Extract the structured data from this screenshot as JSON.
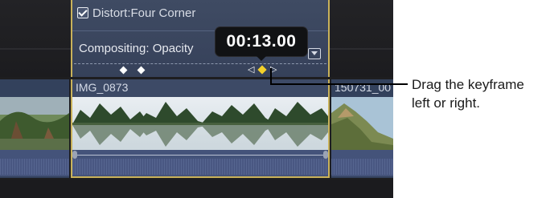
{
  "effect": {
    "distort_label": "Distort:Four Corner",
    "distort_checked": true,
    "opacity_label": "Compositing: Opacity"
  },
  "timecode": "00:13.00",
  "clips": [
    {
      "name": ""
    },
    {
      "name": "IMG_0873"
    },
    {
      "name": "150731_00"
    }
  ],
  "callout": {
    "line1": "Drag the keyframe",
    "line2": "left or right."
  },
  "colors": {
    "selection": "#c9b25a",
    "active_keyframe": "#f4d12a",
    "clip_blue": "#3d4a66"
  },
  "icons": [
    "checkbox-icon",
    "keyframe-icon",
    "previous-keyframe-icon",
    "next-keyframe-icon",
    "menu-dropdown-icon"
  ]
}
